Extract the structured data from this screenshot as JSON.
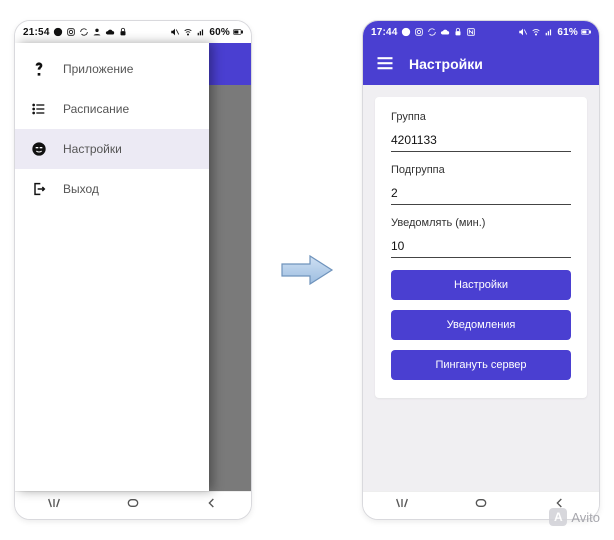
{
  "left": {
    "status": {
      "time": "21:54",
      "battery": "60%"
    },
    "drawer": {
      "items": [
        {
          "icon": "help",
          "label": "Приложение",
          "active": false
        },
        {
          "icon": "list",
          "label": "Расписание",
          "active": false
        },
        {
          "icon": "face",
          "label": "Настройки",
          "active": true
        },
        {
          "icon": "logout",
          "label": "Выход",
          "active": false
        }
      ]
    }
  },
  "right": {
    "status": {
      "time": "17:44",
      "battery": "61%"
    },
    "appbar": {
      "title": "Настройки"
    },
    "fields": [
      {
        "label": "Группа",
        "value": "4201133"
      },
      {
        "label": "Подгруппа",
        "value": "2"
      },
      {
        "label": "Уведомлять (мин.)",
        "value": "10"
      }
    ],
    "buttons": [
      {
        "label": "Настройки"
      },
      {
        "label": "Уведомления"
      },
      {
        "label": "Пингануть сервер"
      }
    ]
  },
  "watermark": "Avito"
}
